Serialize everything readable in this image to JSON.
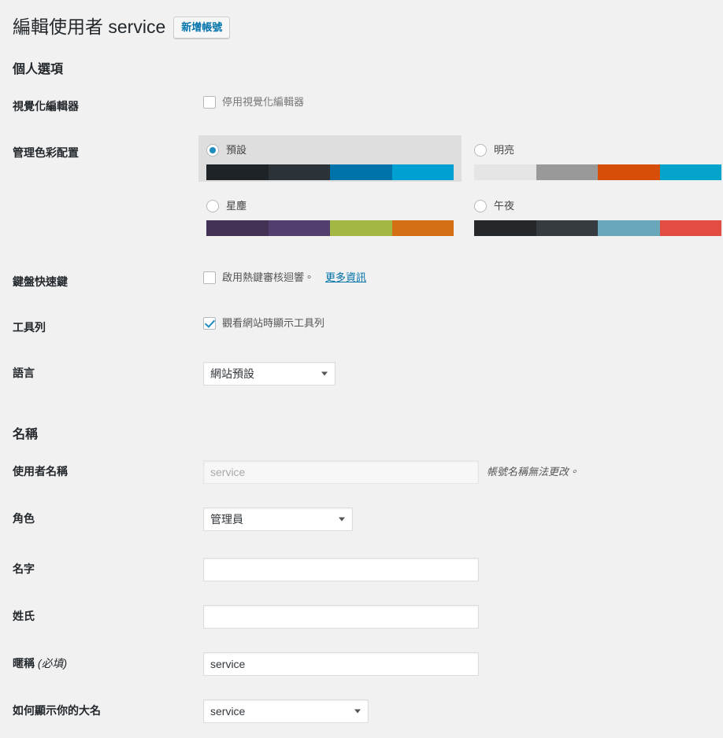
{
  "header": {
    "title": "編輯使用者 service",
    "add_new_label": "新增帳號"
  },
  "sections": {
    "personal_options": "個人選項",
    "names": "名稱"
  },
  "visual_editor": {
    "label": "視覺化編輯器",
    "checkbox_label": "停用視覺化編輯器",
    "checked": false
  },
  "admin_color_scheme": {
    "label": "管理色彩配置",
    "options": [
      {
        "name": "預設",
        "selected": true,
        "colors": [
          "#1d2327",
          "#2c3338",
          "#0073aa",
          "#00a0d2"
        ]
      },
      {
        "name": "明亮",
        "selected": false,
        "colors": [
          "#e5e5e5",
          "#999999",
          "#d64e07",
          "#04a4cc"
        ]
      },
      {
        "name": "星塵",
        "selected": false,
        "colors": [
          "#413256",
          "#523f6d",
          "#a3b745",
          "#d46f15"
        ]
      },
      {
        "name": "午夜",
        "selected": false,
        "colors": [
          "#25282b",
          "#363b3f",
          "#69a8bb",
          "#e14d43"
        ]
      }
    ]
  },
  "keyboard_shortcuts": {
    "label": "鍵盤快速鍵",
    "checkbox_label": "啟用熱鍵審核迴響。",
    "more_info_label": "更多資訊",
    "checked": false
  },
  "toolbar": {
    "label": "工具列",
    "checkbox_label": "觀看網站時顯示工具列",
    "checked": true
  },
  "language": {
    "label": "語言",
    "value": "網站預設"
  },
  "username": {
    "label": "使用者名稱",
    "value": "service",
    "note": "帳號名稱無法更改。"
  },
  "role": {
    "label": "角色",
    "value": "管理員"
  },
  "first_name": {
    "label": "名字",
    "value": ""
  },
  "last_name": {
    "label": "姓氏",
    "value": ""
  },
  "nickname": {
    "label": "暱稱",
    "required_marker": "(必填)",
    "value": "service"
  },
  "display_name": {
    "label": "如何顯示你的大名",
    "value": "service"
  },
  "colors": {
    "accent": "#0073aa",
    "page_background": "#f1f1f1",
    "heading": "#23282d",
    "selected_option_background": "#dedede"
  }
}
